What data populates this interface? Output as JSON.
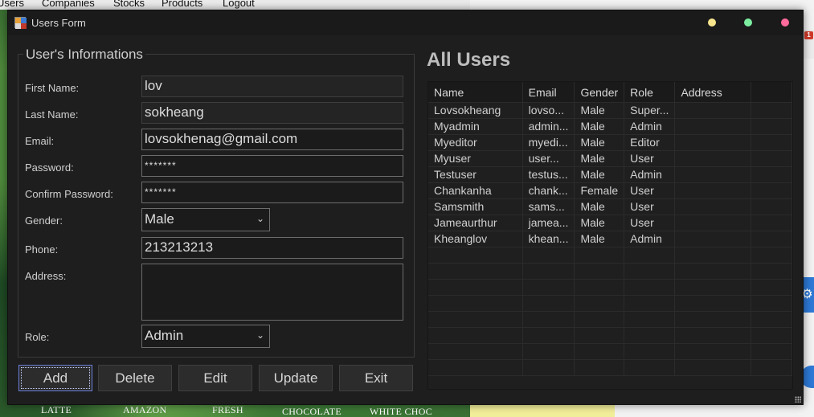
{
  "background": {
    "menu": [
      "Users",
      "Companies",
      "Stocks",
      "Products",
      "Logout"
    ],
    "product_labels": [
      "LATTE",
      "AMAZON",
      "FRESH",
      "CHOCOLATE",
      "WHITE CHOC"
    ],
    "badge": "1"
  },
  "window": {
    "title": "Users Form",
    "controls": {
      "minimize_color": "#f6e58d",
      "maximize_color": "#7bed9f",
      "close_color": "#ff6b9d"
    }
  },
  "form": {
    "group_title": "User's Informations",
    "labels": {
      "first_name": "First Name:",
      "last_name": "Last Name:",
      "email": "Email:",
      "password": "Password:",
      "confirm_password": "Confirm Password:",
      "gender": "Gender:",
      "phone": "Phone:",
      "address": "Address:",
      "role": "Role:"
    },
    "values": {
      "first_name": "lov",
      "last_name": "sokheang",
      "email": "lovsokhenag@gmail.com",
      "password": "*******",
      "confirm_password": "*******",
      "gender": "Male",
      "phone": "213213213",
      "address": "",
      "role": "Admin"
    }
  },
  "buttons": {
    "add": "Add",
    "delete": "Delete",
    "edit": "Edit",
    "update": "Update",
    "exit": "Exit"
  },
  "users_panel": {
    "title": "All Users",
    "columns": [
      "Name",
      "Email",
      "Gender",
      "Role",
      "Address"
    ],
    "rows": [
      [
        "Lovsokheang",
        "lovso...",
        "Male",
        "Super...",
        ""
      ],
      [
        "Myadmin",
        "admin...",
        "Male",
        "Admin",
        ""
      ],
      [
        "Myeditor",
        "myedi...",
        "Male",
        "Editor",
        ""
      ],
      [
        "Myuser",
        "user...",
        "Male",
        "User",
        ""
      ],
      [
        "Testuser",
        "testus...",
        "Male",
        "Admin",
        ""
      ],
      [
        "Chankanha",
        "chank...",
        "Female",
        "User",
        ""
      ],
      [
        "Samsmith",
        "sams...",
        "Male",
        "User",
        ""
      ],
      [
        "Jameaurthur",
        "jamea...",
        "Male",
        "User",
        ""
      ],
      [
        "Kheanglov",
        "khean...",
        "Male",
        "Admin",
        ""
      ]
    ]
  }
}
